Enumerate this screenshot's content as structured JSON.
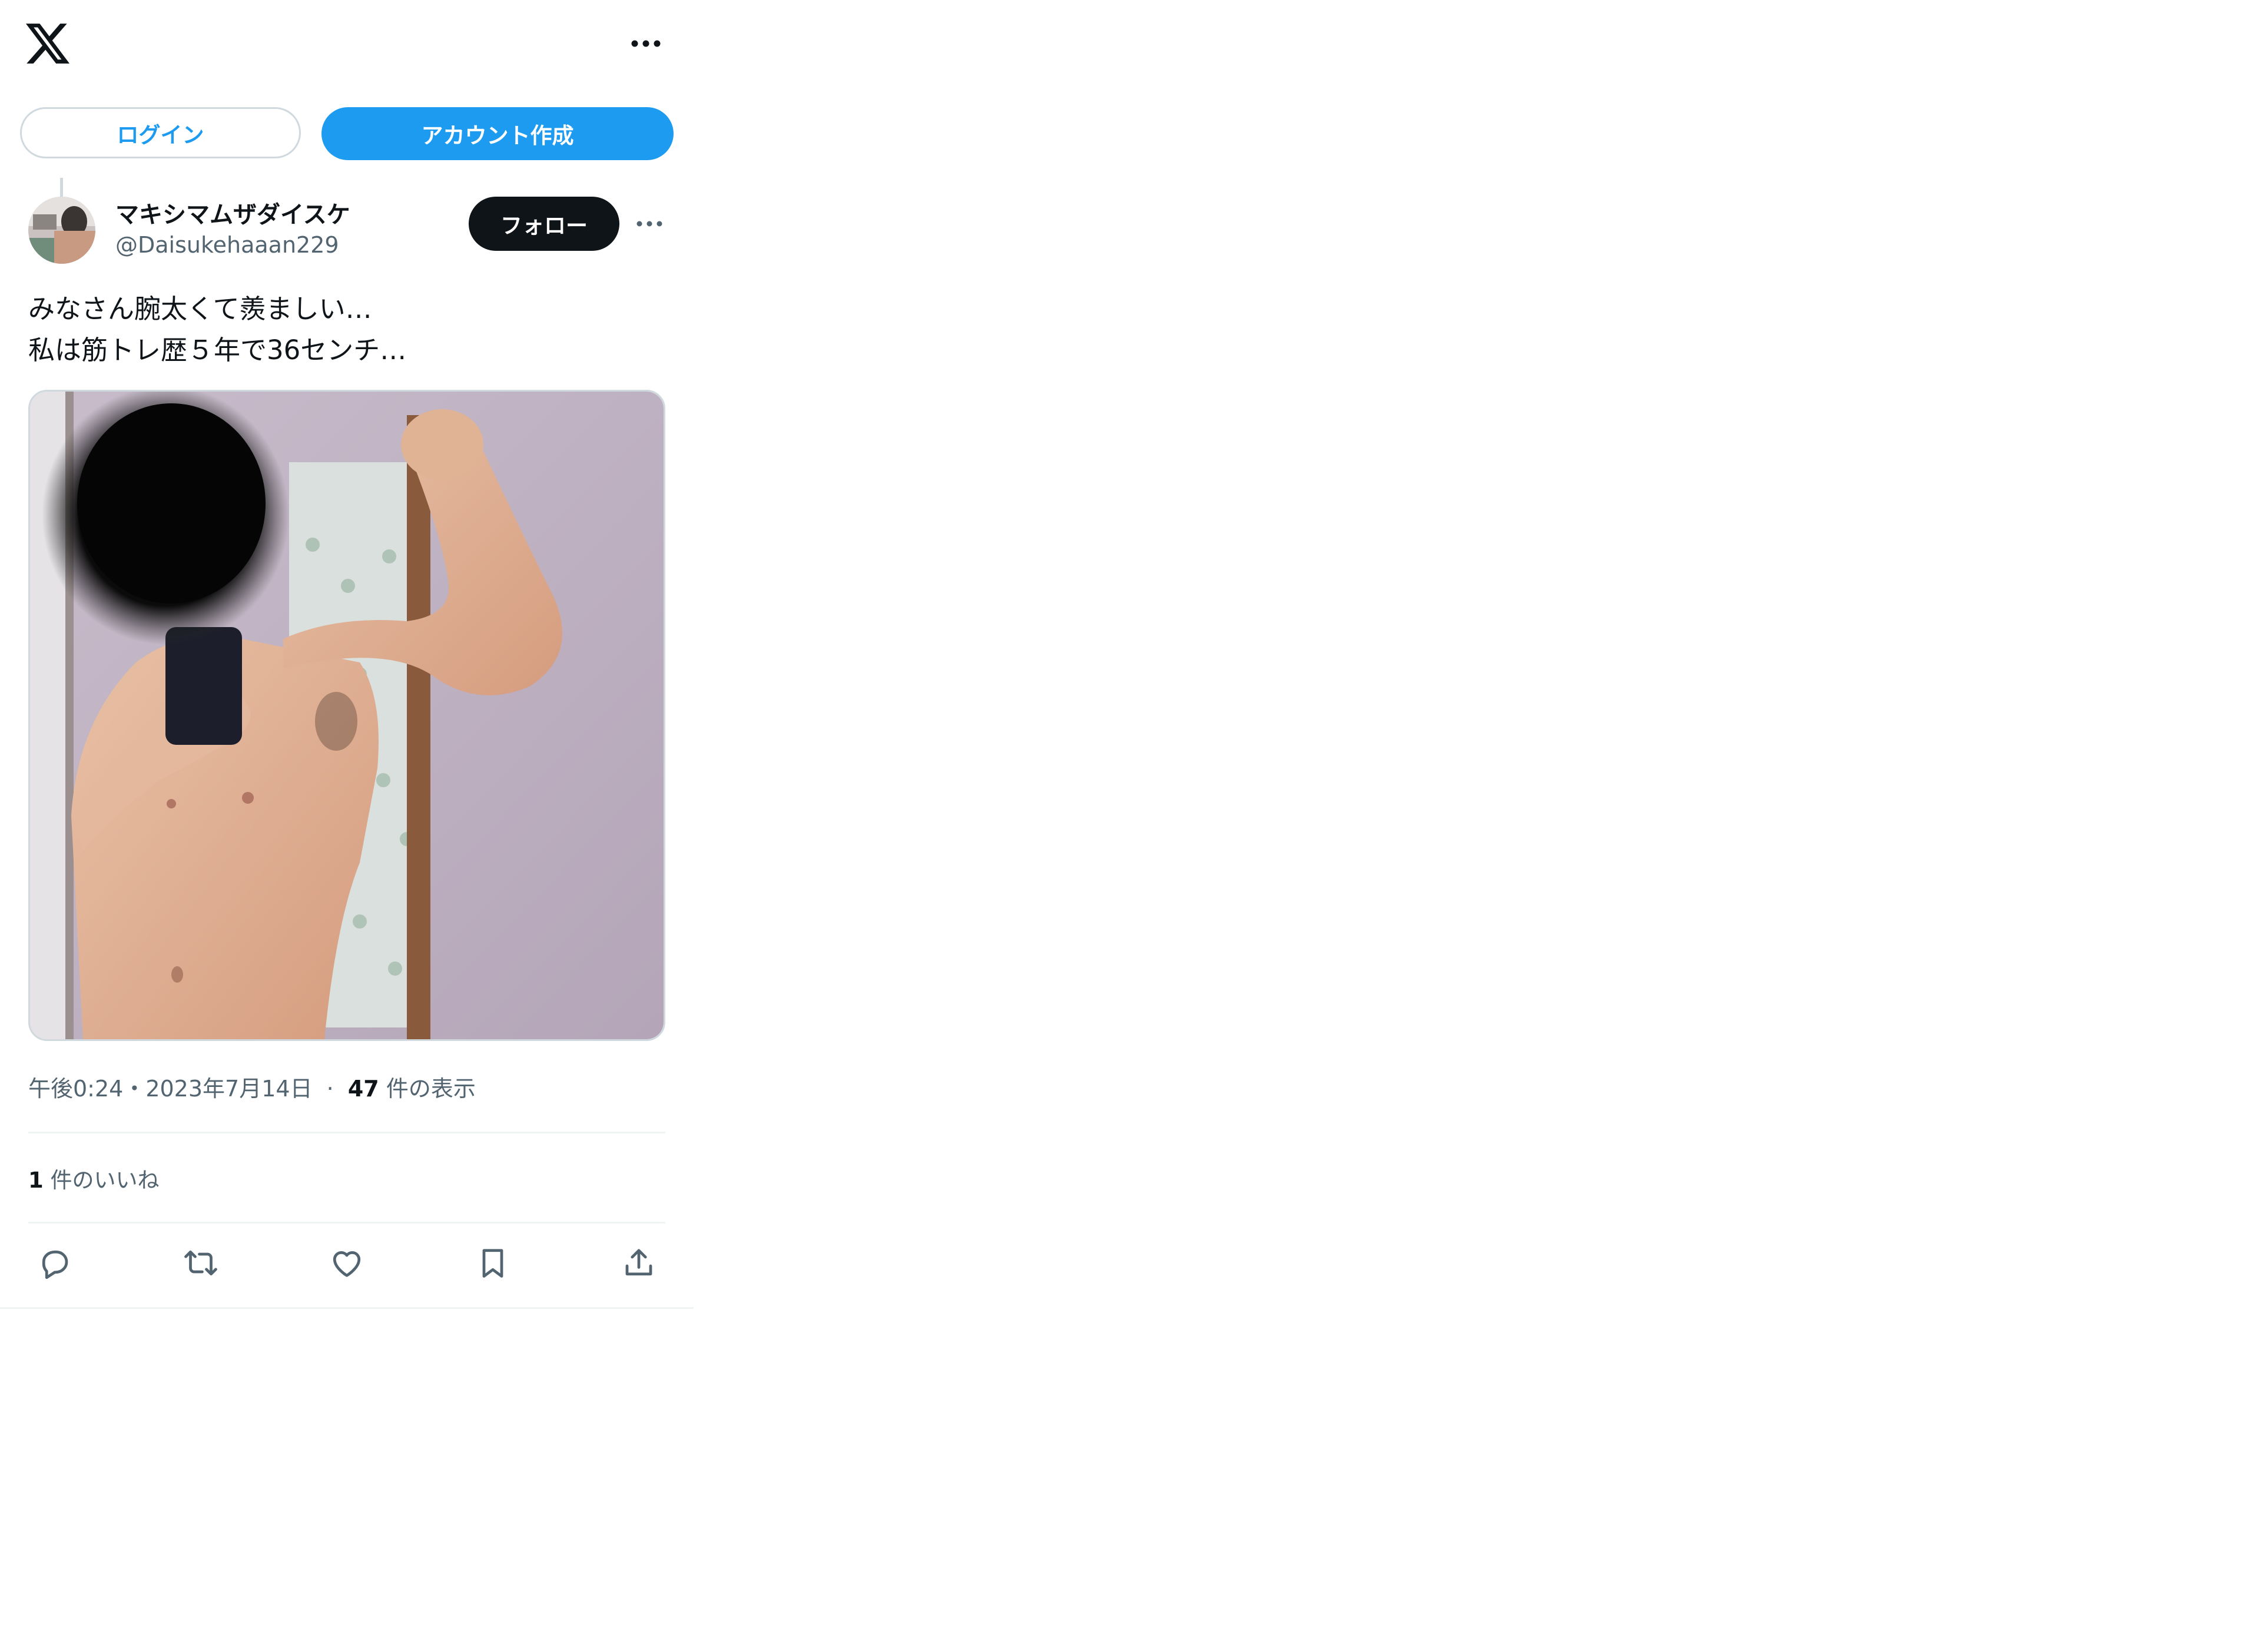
{
  "header": {
    "logo_icon": "x-logo-icon",
    "more_icon": "more-horizontal-icon"
  },
  "auth": {
    "login_label": "ログイン",
    "signup_label": "アカウント作成"
  },
  "post": {
    "author": {
      "display_name": "マキシマムザダイスケ",
      "handle": "@Daisukehaaan229"
    },
    "follow_label": "フォロー",
    "text": "みなさん腕太くて羨ましい…\n私は筋トレ歴５年で36センチ…",
    "timestamp": "午後0:24・2023年7月14日",
    "separator": "·",
    "views_count": "47",
    "views_label": "件の表示",
    "likes_count": "1",
    "likes_label": "件のいいね"
  },
  "actions": [
    {
      "name": "reply",
      "icon": "reply-icon"
    },
    {
      "name": "repost",
      "icon": "repost-icon"
    },
    {
      "name": "like",
      "icon": "heart-icon"
    },
    {
      "name": "bookmark",
      "icon": "bookmark-icon"
    },
    {
      "name": "share",
      "icon": "share-icon"
    }
  ],
  "colors": {
    "accent": "#1d9bf0",
    "text_primary": "#0f1419",
    "text_secondary": "#536471",
    "border": "#cfd9de",
    "divider": "#eff3f4",
    "follow_bg": "#0f1419"
  }
}
